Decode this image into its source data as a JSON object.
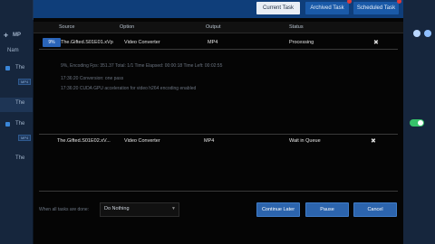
{
  "sidebar": {
    "mp_label": "MP",
    "name_label": "Nam",
    "items": [
      {
        "label": "The",
        "tag": "MP4"
      },
      {
        "label": "The",
        "tag": "MP4"
      },
      {
        "label": "The",
        "tag": "MP4"
      },
      {
        "label": "The",
        "tag": ""
      }
    ]
  },
  "dialog": {
    "tabs": [
      {
        "label": "Current Task"
      },
      {
        "label": "Archived Task"
      },
      {
        "label": "Scheduled Task"
      }
    ],
    "columns": [
      "Source",
      "Option",
      "Output",
      "Status"
    ],
    "row1": {
      "progress": "9%",
      "source": "The.Gifted.S01E01.xVp",
      "option": "Video Converter",
      "output": "MP4",
      "status": "Processing",
      "close": "✖"
    },
    "log": [
      "9%, Encoding Fps: 351.37   Total: 1/1  Time Elapsed: 00:00:18  Time Left: 00:02:55",
      "17:36:20    Conversion: one pass",
      "17:36:20    CUDA GPU acceleration for video h264 encoding enabled"
    ],
    "row2": {
      "source": "The.Gifted.S01E02.xV...",
      "option": "Video Converter",
      "output": "MP4",
      "status": "Wait in Queue",
      "close": "✖"
    },
    "footer": {
      "when_done_label": "When all tasks are done:",
      "when_done_value": "Do Nothing",
      "continue_later": "Continue Later",
      "pause": "Pause",
      "cancel": "Cancel"
    }
  }
}
